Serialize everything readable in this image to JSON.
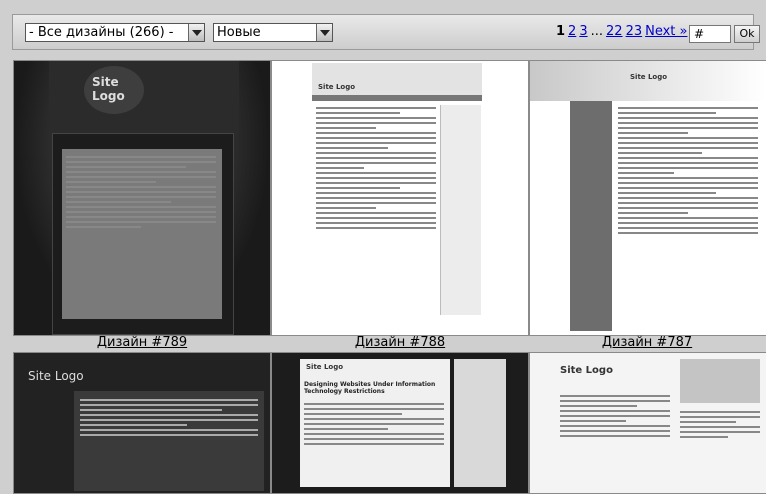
{
  "toolbar": {
    "designs_select": "- Все дизайны (266) -",
    "sort_select": "Новые",
    "pager": {
      "current": "1",
      "pages": [
        "2",
        "3"
      ],
      "dots": "...",
      "last_pages": [
        "22",
        "23"
      ],
      "next": "Next »"
    },
    "page_input_value": "#",
    "ok_label": "Ok"
  },
  "designs": [
    {
      "caption": "Дизайн #789",
      "logo": "Site Logo"
    },
    {
      "caption": "Дизайн #788",
      "logo": "Site Logo"
    },
    {
      "caption": "Дизайн #787",
      "logo": "Site Logo"
    }
  ],
  "designs_row2": [
    {
      "logo": "Site Logo",
      "heading": ""
    },
    {
      "logo": "Site Logo",
      "heading": "Designing Websites Under Information Technology Restrictions"
    },
    {
      "logo": "Site Logo",
      "heading": ""
    }
  ]
}
